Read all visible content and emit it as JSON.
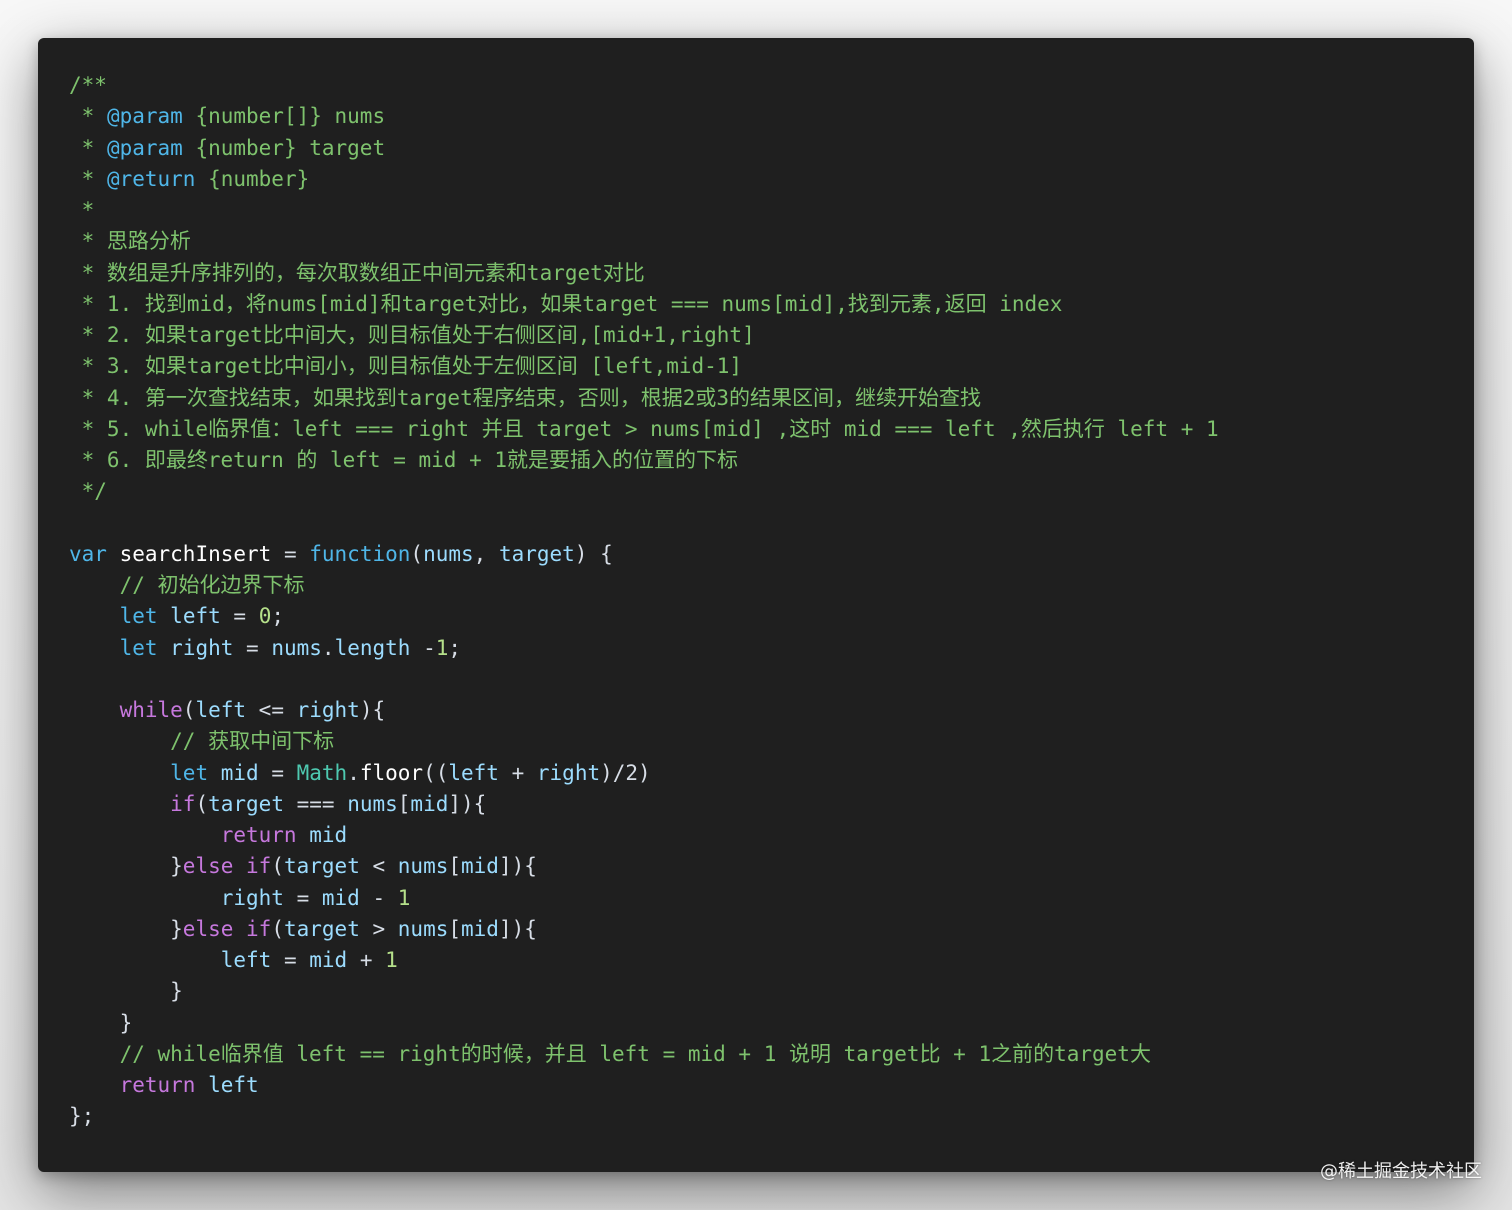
{
  "code_lines": [
    [
      {
        "text": "/**",
        "t": "comment"
      }
    ],
    [
      {
        "text": " * ",
        "t": "comment"
      },
      {
        "text": "@param",
        "t": "tag"
      },
      {
        "text": " {number[]} nums",
        "t": "comment"
      }
    ],
    [
      {
        "text": " * ",
        "t": "comment"
      },
      {
        "text": "@param",
        "t": "tag"
      },
      {
        "text": " {number} target",
        "t": "comment"
      }
    ],
    [
      {
        "text": " * ",
        "t": "comment"
      },
      {
        "text": "@return",
        "t": "tag"
      },
      {
        "text": " {number}",
        "t": "comment"
      }
    ],
    [
      {
        "text": " *",
        "t": "comment"
      }
    ],
    [
      {
        "text": " * 思路分析",
        "t": "comment"
      }
    ],
    [
      {
        "text": " * 数组是升序排列的，每次取数组正中间元素和target对比",
        "t": "comment"
      }
    ],
    [
      {
        "text": " * 1. 找到mid，将nums[mid]和target对比，如果target === nums[mid],找到元素,返回 index",
        "t": "comment"
      }
    ],
    [
      {
        "text": " * 2. 如果target比中间大，则目标值处于右侧区间,[mid+1,right]",
        "t": "comment"
      }
    ],
    [
      {
        "text": " * 3. 如果target比中间小，则目标值处于左侧区间 [left,mid-1]",
        "t": "comment"
      }
    ],
    [
      {
        "text": " * 4. 第一次查找结束，如果找到target程序结束，否则，根据2或3的结果区间，继续开始查找",
        "t": "comment"
      }
    ],
    [
      {
        "text": " * 5. while临界值：left === right 并且 target > nums[mid] ,这时 mid === left ,然后执行 left + 1",
        "t": "comment"
      }
    ],
    [
      {
        "text": " * 6. 即最终return 的 left = mid + 1就是要插入的位置的下标",
        "t": "comment"
      }
    ],
    [
      {
        "text": " */",
        "t": "comment"
      }
    ],
    [],
    [
      {
        "text": "var",
        "t": "kw"
      },
      {
        "text": " ",
        "t": "plain"
      },
      {
        "text": "searchInsert",
        "t": "fn"
      },
      {
        "text": " = ",
        "t": "plain"
      },
      {
        "text": "function",
        "t": "kw"
      },
      {
        "text": "(",
        "t": "plain"
      },
      {
        "text": "nums",
        "t": "var"
      },
      {
        "text": ", ",
        "t": "plain"
      },
      {
        "text": "target",
        "t": "var"
      },
      {
        "text": ") {",
        "t": "plain"
      }
    ],
    [
      {
        "text": "    // 初始化边界下标",
        "t": "comment"
      }
    ],
    [
      {
        "text": "    ",
        "t": "plain"
      },
      {
        "text": "let",
        "t": "kw"
      },
      {
        "text": " ",
        "t": "plain"
      },
      {
        "text": "left",
        "t": "var"
      },
      {
        "text": " = ",
        "t": "plain"
      },
      {
        "text": "0",
        "t": "num"
      },
      {
        "text": ";",
        "t": "plain"
      }
    ],
    [
      {
        "text": "    ",
        "t": "plain"
      },
      {
        "text": "let",
        "t": "kw"
      },
      {
        "text": " ",
        "t": "plain"
      },
      {
        "text": "right",
        "t": "var"
      },
      {
        "text": " = ",
        "t": "plain"
      },
      {
        "text": "nums",
        "t": "var"
      },
      {
        "text": ".",
        "t": "plain"
      },
      {
        "text": "length",
        "t": "var"
      },
      {
        "text": " -",
        "t": "plain"
      },
      {
        "text": "1",
        "t": "num"
      },
      {
        "text": ";",
        "t": "plain"
      }
    ],
    [],
    [
      {
        "text": "    ",
        "t": "plain"
      },
      {
        "text": "while",
        "t": "ctrl"
      },
      {
        "text": "(",
        "t": "plain"
      },
      {
        "text": "left",
        "t": "var"
      },
      {
        "text": " <= ",
        "t": "plain"
      },
      {
        "text": "right",
        "t": "var"
      },
      {
        "text": "){",
        "t": "plain"
      }
    ],
    [
      {
        "text": "        // 获取中间下标",
        "t": "comment"
      }
    ],
    [
      {
        "text": "        ",
        "t": "plain"
      },
      {
        "text": "let",
        "t": "kw"
      },
      {
        "text": " ",
        "t": "plain"
      },
      {
        "text": "mid",
        "t": "var"
      },
      {
        "text": " = ",
        "t": "plain"
      },
      {
        "text": "Math",
        "t": "cls"
      },
      {
        "text": ".",
        "t": "plain"
      },
      {
        "text": "floor",
        "t": "fn"
      },
      {
        "text": "((",
        "t": "plain"
      },
      {
        "text": "left",
        "t": "var"
      },
      {
        "text": " + ",
        "t": "plain"
      },
      {
        "text": "right",
        "t": "var"
      },
      {
        "text": ")/2)",
        "t": "plain"
      }
    ],
    [
      {
        "text": "        ",
        "t": "plain"
      },
      {
        "text": "if",
        "t": "ctrl"
      },
      {
        "text": "(",
        "t": "plain"
      },
      {
        "text": "target",
        "t": "var"
      },
      {
        "text": " === ",
        "t": "plain"
      },
      {
        "text": "nums",
        "t": "var"
      },
      {
        "text": "[",
        "t": "plain"
      },
      {
        "text": "mid",
        "t": "var"
      },
      {
        "text": "]){",
        "t": "plain"
      }
    ],
    [
      {
        "text": "            ",
        "t": "plain"
      },
      {
        "text": "return",
        "t": "ctrl"
      },
      {
        "text": " ",
        "t": "plain"
      },
      {
        "text": "mid",
        "t": "var"
      }
    ],
    [
      {
        "text": "        }",
        "t": "plain"
      },
      {
        "text": "else",
        "t": "ctrl"
      },
      {
        "text": " ",
        "t": "plain"
      },
      {
        "text": "if",
        "t": "ctrl"
      },
      {
        "text": "(",
        "t": "plain"
      },
      {
        "text": "target",
        "t": "var"
      },
      {
        "text": " < ",
        "t": "plain"
      },
      {
        "text": "nums",
        "t": "var"
      },
      {
        "text": "[",
        "t": "plain"
      },
      {
        "text": "mid",
        "t": "var"
      },
      {
        "text": "]){",
        "t": "plain"
      }
    ],
    [
      {
        "text": "            ",
        "t": "plain"
      },
      {
        "text": "right",
        "t": "var"
      },
      {
        "text": " = ",
        "t": "plain"
      },
      {
        "text": "mid",
        "t": "var"
      },
      {
        "text": " - ",
        "t": "plain"
      },
      {
        "text": "1",
        "t": "num"
      }
    ],
    [
      {
        "text": "        }",
        "t": "plain"
      },
      {
        "text": "else",
        "t": "ctrl"
      },
      {
        "text": " ",
        "t": "plain"
      },
      {
        "text": "if",
        "t": "ctrl"
      },
      {
        "text": "(",
        "t": "plain"
      },
      {
        "text": "target",
        "t": "var"
      },
      {
        "text": " > ",
        "t": "plain"
      },
      {
        "text": "nums",
        "t": "var"
      },
      {
        "text": "[",
        "t": "plain"
      },
      {
        "text": "mid",
        "t": "var"
      },
      {
        "text": "]){",
        "t": "plain"
      }
    ],
    [
      {
        "text": "            ",
        "t": "plain"
      },
      {
        "text": "left",
        "t": "var"
      },
      {
        "text": " = ",
        "t": "plain"
      },
      {
        "text": "mid",
        "t": "var"
      },
      {
        "text": " + ",
        "t": "plain"
      },
      {
        "text": "1",
        "t": "num"
      }
    ],
    [
      {
        "text": "        }",
        "t": "plain"
      }
    ],
    [
      {
        "text": "    }",
        "t": "plain"
      }
    ],
    [
      {
        "text": "    // while临界值 left == right的时候，并且 left = mid + 1 说明 target比 + 1之前的target大",
        "t": "comment"
      }
    ],
    [
      {
        "text": "    ",
        "t": "plain"
      },
      {
        "text": "return",
        "t": "ctrl"
      },
      {
        "text": " ",
        "t": "plain"
      },
      {
        "text": "left",
        "t": "var"
      }
    ],
    [
      {
        "text": "};",
        "t": "plain"
      }
    ]
  ],
  "watermark": "@稀土掘金技术社区"
}
